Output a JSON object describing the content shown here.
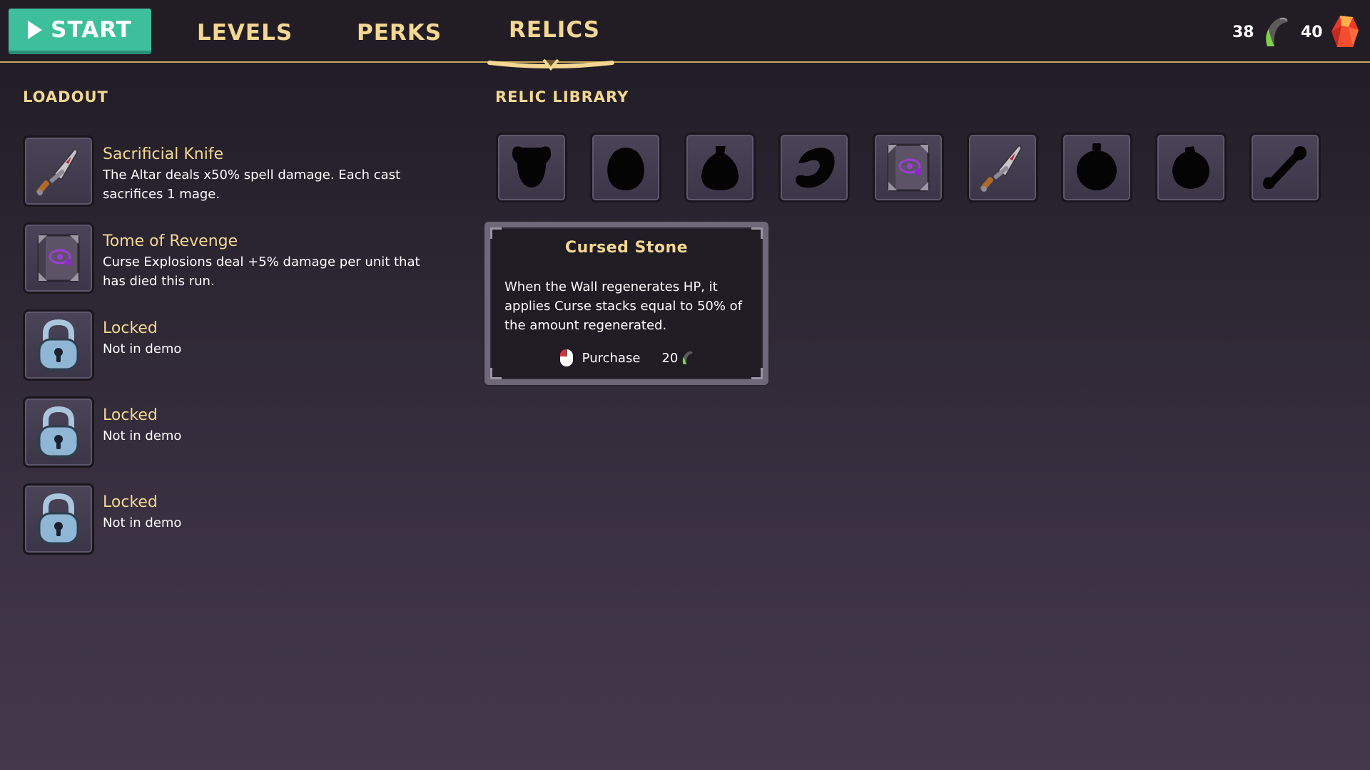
{
  "nav": {
    "start_label": "START",
    "tabs": [
      {
        "label": "LEVELS"
      },
      {
        "label": "PERKS"
      },
      {
        "label": "RELICS",
        "active": true
      }
    ]
  },
  "currencies": {
    "horns": {
      "amount": "38",
      "icon": "horn-icon"
    },
    "gems": {
      "amount": "40",
      "icon": "red-gem-icon"
    }
  },
  "loadout": {
    "title": "LOADOUT",
    "items": [
      {
        "name": "Sacrificial Knife",
        "desc": "The Altar deals x50% spell damage. Each cast sacrifices 1 mage.",
        "icon": "dagger-icon"
      },
      {
        "name": "Tome of Revenge",
        "desc": "Curse Explosions deal +5% damage per unit that has died this run.",
        "icon": "tome-icon"
      },
      {
        "name": "Locked",
        "desc": "Not in demo",
        "icon": "padlock-icon"
      },
      {
        "name": "Locked",
        "desc": "Not in demo",
        "icon": "padlock-icon"
      },
      {
        "name": "Locked",
        "desc": "Not in demo",
        "icon": "padlock-icon"
      }
    ]
  },
  "library": {
    "title": "RELIC LIBRARY",
    "slots": [
      {
        "icon": "silhouette-trophy-icon"
      },
      {
        "icon": "silhouette-stone-icon"
      },
      {
        "icon": "silhouette-pouch-icon"
      },
      {
        "icon": "silhouette-horn-icon"
      },
      {
        "icon": "tome-icon"
      },
      {
        "icon": "dagger-icon"
      },
      {
        "icon": "silhouette-stopwatch-icon"
      },
      {
        "icon": "silhouette-bomb-icon"
      },
      {
        "icon": "silhouette-bone-icon"
      }
    ]
  },
  "tooltip": {
    "title": "Cursed Stone",
    "desc": "When the Wall regenerates HP, it applies Curse stacks equal to 50% of the amount regenerated.",
    "action_label": "Purchase",
    "cost": "20",
    "cost_icon": "horn-icon",
    "action_icon": "mouse-left-click-icon"
  },
  "colors": {
    "accent_gold": "#f3d792",
    "start_green": "#3dbf9c",
    "background": "#2a2430"
  }
}
